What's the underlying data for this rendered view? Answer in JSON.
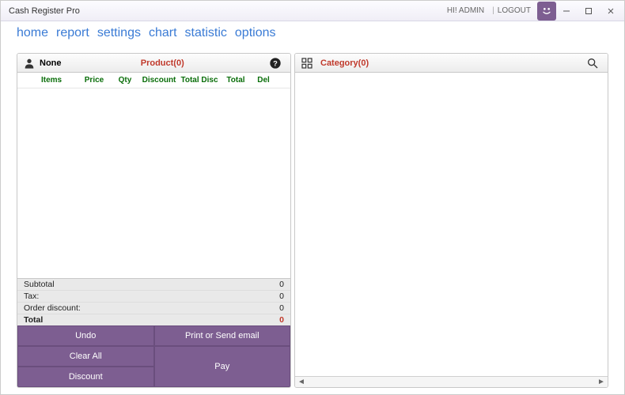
{
  "titlebar": {
    "app_title": "Cash Register Pro",
    "greeting": "HI! ADMIN",
    "logout": "LOGOUT"
  },
  "nav": {
    "home": "home",
    "report": "report",
    "settings": "settings",
    "chart": "chart",
    "statistic": "statistic",
    "options": "options"
  },
  "left_header": {
    "customer": "None",
    "product": "Product(0)"
  },
  "right_header": {
    "category": "Category(0)"
  },
  "columns": {
    "items": "Items",
    "price": "Price",
    "qty": "Qty",
    "discount": "Discount",
    "total_disc": "Total Disc",
    "total": "Total",
    "del": "Del"
  },
  "totals": {
    "subtotal_label": "Subtotal",
    "subtotal_value": "0",
    "tax_label": "Tax:",
    "tax_value": "0",
    "order_discount_label": "Order discount:",
    "order_discount_value": "0",
    "total_label": "Total",
    "total_value": "0"
  },
  "buttons": {
    "undo": "Undo",
    "print": "Print or Send email",
    "clear_all": "Clear All",
    "discount": "Discount",
    "pay": "Pay"
  },
  "footer": {
    "left_arrow": "◄",
    "right_arrow": "►"
  }
}
